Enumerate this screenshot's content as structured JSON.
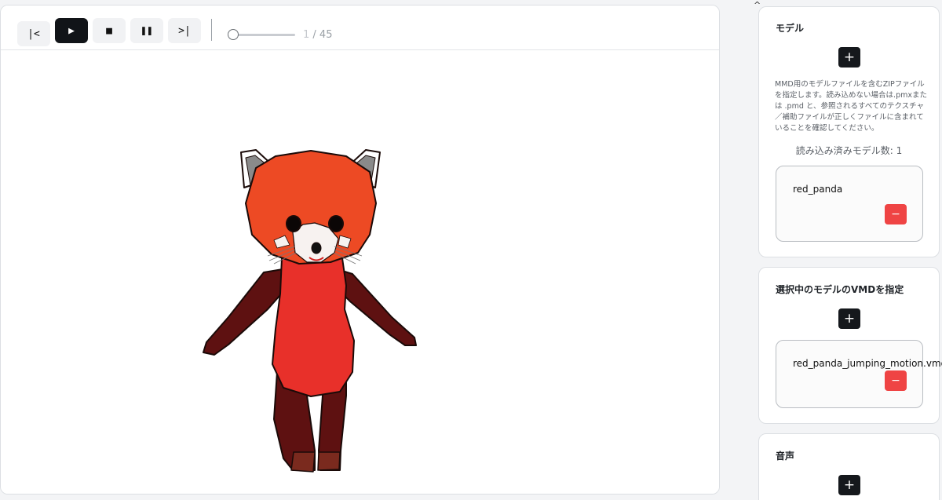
{
  "toolbar": {
    "first_label": "|<",
    "play_label": "▶",
    "stop_label": "■",
    "pause_label": "❚❚",
    "last_label": ">|",
    "frame_current": "1",
    "frame_total": "/ 45"
  },
  "sidebar": {
    "collapse_icon": "^",
    "model": {
      "title": "モデル",
      "add_label": "+",
      "description": "MMD用のモデルファイルを含むZIPファイルを指定します。読み込めない場合は.pmxまたは .pmd と、参照されるすべてのテクスチャ／補助ファイルが正しくファイルに含まれていることを確認してください。",
      "count_label": "読み込み済みモデル数: 1",
      "items": [
        {
          "name": "red_panda",
          "remove_label": "−"
        }
      ]
    },
    "vmd": {
      "title": "選択中のモデルのVMDを指定",
      "add_label": "+",
      "items": [
        {
          "name": "red_panda_jumping_motion.vmd",
          "remove_label": "−"
        }
      ]
    },
    "audio": {
      "title": "音声",
      "add_label": "+"
    }
  },
  "colors": {
    "accent_dark": "#15181c",
    "danger": "#ef4444",
    "panda_red": "#e8442a",
    "panda_dark": "#5e1111"
  }
}
